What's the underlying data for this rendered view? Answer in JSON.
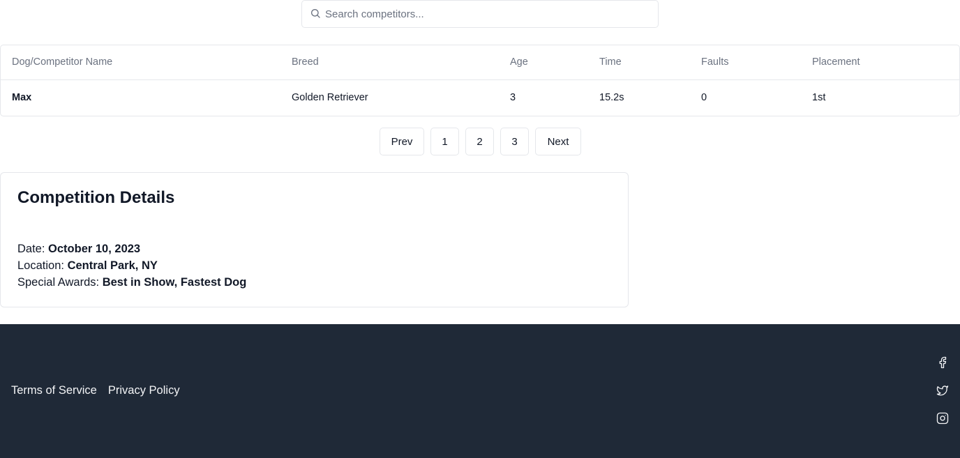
{
  "search": {
    "placeholder": "Search competitors...",
    "value": ""
  },
  "table": {
    "headers": [
      "Dog/Competitor Name",
      "Breed",
      "Age",
      "Time",
      "Faults",
      "Placement"
    ],
    "rows": [
      [
        "Max",
        "Golden Retriever",
        "3",
        "15.2s",
        "0",
        "1st"
      ]
    ]
  },
  "pagination": {
    "prev": "Prev",
    "pages": [
      "1",
      "2",
      "3"
    ],
    "next": "Next"
  },
  "details": {
    "title": "Competition Details",
    "date_label": "Date:",
    "date_value": "October 10, 2023",
    "location_label": "Location:",
    "location_value": "Central Park, NY",
    "awards_label": "Special Awards:",
    "awards_value": "Best in Show, Fastest Dog"
  },
  "footer": {
    "links": [
      "Terms of Service",
      "Privacy Policy"
    ],
    "social_icons": [
      "facebook-icon",
      "twitter-icon",
      "instagram-icon"
    ],
    "background": "#1f2937"
  }
}
